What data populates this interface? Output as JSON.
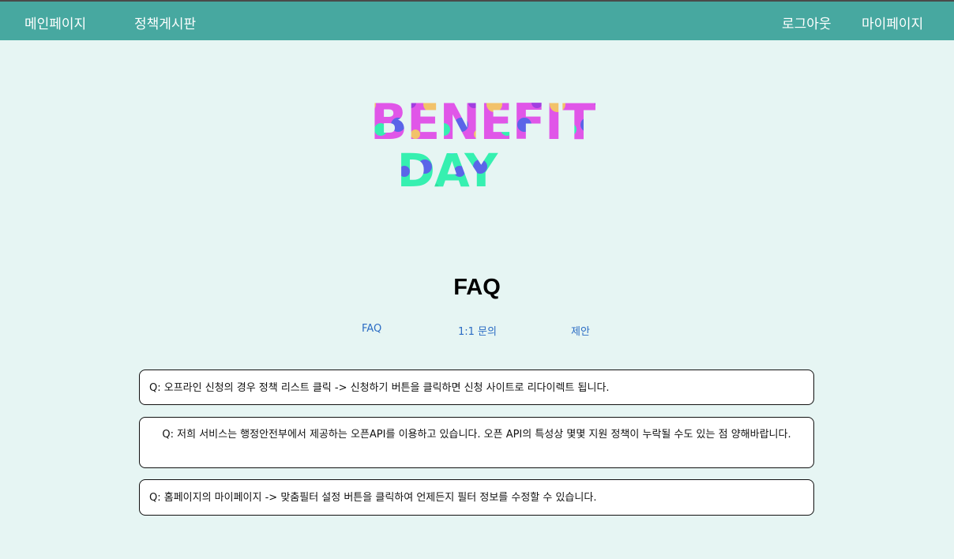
{
  "nav": {
    "home": "메인페이지",
    "policy_board": "정책게시판",
    "logout": "로그아웃",
    "mypage": "마이페이지"
  },
  "logo": {
    "line1": "BENEFIT",
    "line2": "DAY",
    "colors": {
      "pink": "#e056e8",
      "purple": "#a13ee0",
      "mint": "#36f0b0",
      "blue": "#5b64e8",
      "yellow": "#f2c26a"
    }
  },
  "page": {
    "title": "FAQ"
  },
  "tabs": [
    {
      "label": "FAQ"
    },
    {
      "label": "1:1 문의"
    },
    {
      "label": "제안"
    }
  ],
  "faqs": [
    {
      "text": "Q: 오프라인 신청의 경우 정책 리스트 클릭 -> 신청하기 버튼을 클릭하면 신청 사이트로 리다이렉트 됩니다."
    },
    {
      "text": "Q: 저희 서비스는 행정안전부에서 제공하는 오픈API를 이용하고 있습니다. 오픈 API의 특성상 몇몇 지원 정책이 누락될 수도 있는 점 양해바랍니다."
    },
    {
      "text": "Q: 홈페이지의 마이페이지 -> 맞춤필터 설정 버튼을 클릭하여 언제든지 필터 정보를 수정할 수 있습니다."
    }
  ],
  "theme": {
    "header_bg": "#47a8a0",
    "page_bg": "#e6f5f3",
    "link_color": "#2b6cc4"
  }
}
